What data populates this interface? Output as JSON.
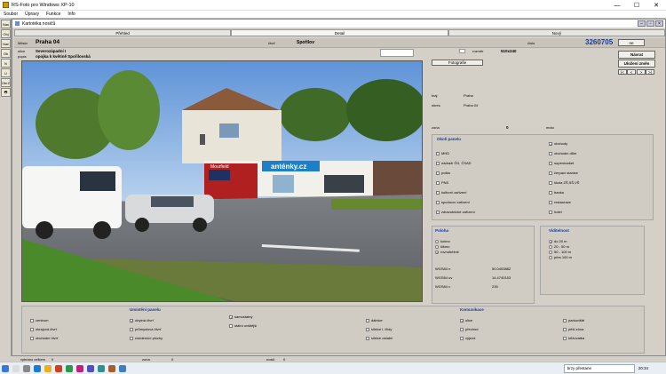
{
  "window": {
    "title": "RS-Foto pro Windows XP-10",
    "controls": [
      "—",
      "☐",
      "✕"
    ]
  },
  "menu": [
    "Soubor",
    "Úpravy",
    "Funkce",
    "Info"
  ],
  "leftbar": [
    "Nas",
    "Obj",
    "Nač",
    "Ob",
    "N",
    "U",
    "ObrZ",
    "🖶"
  ],
  "inner": {
    "title": "Kartotéka nosičů",
    "controls": [
      "–",
      "▫",
      "×"
    ]
  },
  "tabs": [
    "Přehled",
    "Detail",
    "Nový"
  ],
  "header": {
    "mesto_label": "Město",
    "mesto": "Praha 04",
    "ctvrt_label": "čtvrť",
    "ctvrt": "Spořilov",
    "cislo_label": "číslo",
    "cislo": "3260705",
    "ne_btn": "ne",
    "ulice_label": "ulice",
    "ulice": "Severozápadní I",
    "popis_label": "popis",
    "popis": "opojka k květině Spořilovská",
    "rozmer_label": "rozměr",
    "rozmer": "510x240",
    "fotografie_btn": "Fotografie",
    "navrat_btn": "Návrat",
    "ulozeni_btn": "Uložení změn",
    "nav_btns": [
      "|<",
      "<",
      ">",
      ">|"
    ]
  },
  "photo": {
    "sign": "anténky.cz",
    "billboard": "Mourfield"
  },
  "info": {
    "kraj_label": "kraj",
    "kraj": "Praha",
    "okres_label": "okres",
    "okres": "Praha 04",
    "zona_label": "zona",
    "zona": "0",
    "moto_label": "moto"
  },
  "okoli": {
    "title": "Okolí panelu",
    "left": [
      "MHD",
      "nádraží ČD, ČSAD",
      "pošta",
      "PNS",
      "kulturní zařízení",
      "sportovní zařízení",
      "zdravotnické zařízení"
    ],
    "right": [
      "obchody",
      "obchodní dům",
      "supermarket",
      "čerpací stanice",
      "škola ZŠ,SŠ,VŠ",
      "banka",
      "restaurace",
      "hotel"
    ],
    "checked_right": [
      0
    ]
  },
  "poloha": {
    "title": "Poloha",
    "options": [
      "kolmo",
      "šikmo",
      "rovnoběžné"
    ],
    "selected": 2,
    "coords": [
      {
        "label": "WGS84 n",
        "value": "50.0453882"
      },
      {
        "label": "WGS84 ov",
        "value": "14.4740153"
      },
      {
        "label": "WGS84 v",
        "value": "235"
      }
    ]
  },
  "viditelnost": {
    "title": "Viditelnost",
    "options": [
      "do 20 m",
      "20 - 50 m",
      "50 - 100 m",
      "přes 100 m"
    ],
    "selected": 0
  },
  "umisteni": {
    "title": "Umístění panelu",
    "col1": [
      "centrum",
      "okrajová čtvrť",
      "obchodní čtvrť"
    ],
    "col2": [
      "obytná čtvrť",
      "průmyslová čtvrť",
      "rezidenční plochy"
    ],
    "col3": [
      "samostatný",
      "státní ovšitější"
    ],
    "checked2": [
      0
    ],
    "checked3": [
      0
    ]
  },
  "komunikace": {
    "title": "Komunikace",
    "col0": [
      "dálnice",
      "silnice I. třídy",
      "silnice ostatní"
    ],
    "col1": [
      "ulice",
      "přechod",
      "výjezd"
    ],
    "col2": [
      "parkoviště",
      "pěší zóna",
      "křižovatka"
    ],
    "checked1": [
      0
    ]
  },
  "status": {
    "vybrano_label": "vybráno celkem",
    "vybrano": "0",
    "zona_label": "zona",
    "zona": "0",
    "nosic_label": "nosič",
    "nosic": "0"
  },
  "taskbar": {
    "search": "brzy přestane",
    "time": "20:34"
  },
  "colors": {
    "accent": "#1a3c8c",
    "panel": "#d0ccc4"
  }
}
